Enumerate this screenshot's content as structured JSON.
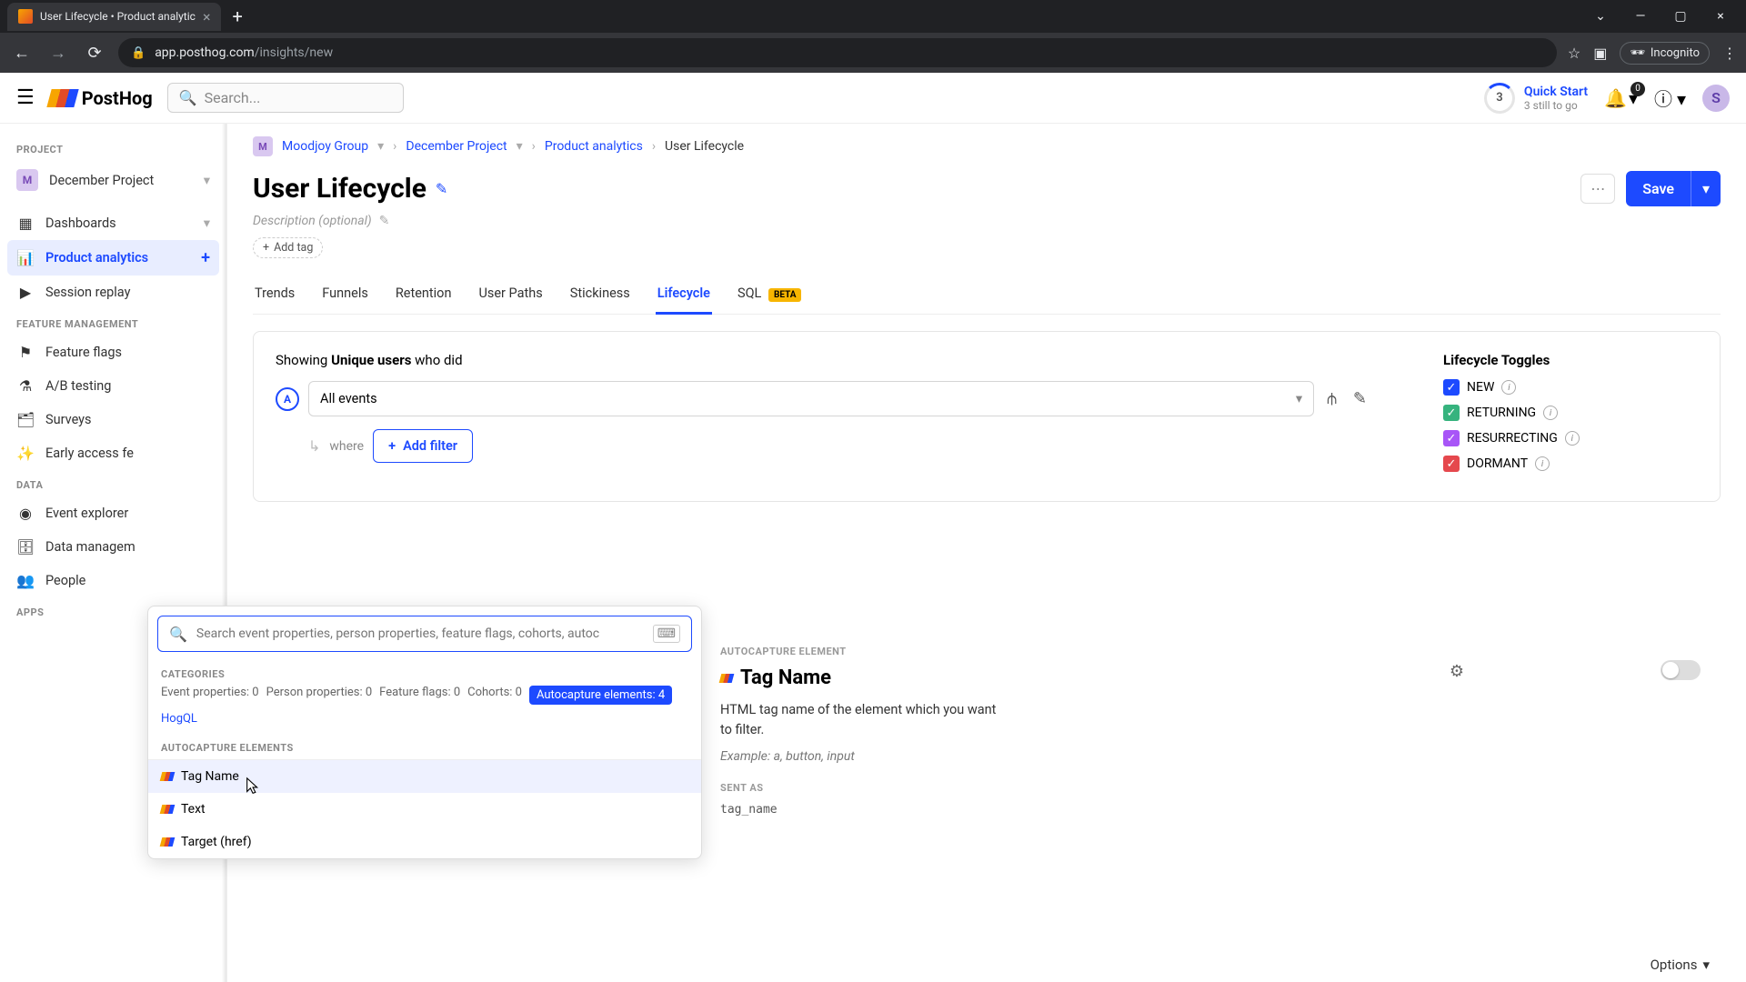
{
  "browser": {
    "tab_title": "User Lifecycle • Product analytic",
    "url_host": "app.posthog.com",
    "url_path": "/insights/new",
    "incognito_label": "Incognito"
  },
  "header": {
    "search_placeholder": "Search...",
    "quick_start": {
      "count": "3",
      "title": "Quick Start",
      "subtitle": "3 still to go"
    },
    "notifications": "0",
    "avatar_letter": "S"
  },
  "sidebar": {
    "project_label": "PROJECT",
    "project_name": "December Project",
    "project_initial": "M",
    "items_main": [
      {
        "icon": "◫",
        "label": "Dashboards",
        "caret": true
      },
      {
        "icon": "⫾⫾",
        "label": "Product analytics",
        "active": true,
        "plus": true
      },
      {
        "icon": "▷",
        "label": "Session replay"
      }
    ],
    "feature_label": "FEATURE MANAGEMENT",
    "items_feature": [
      {
        "icon": "⚑",
        "label": "Feature flags"
      },
      {
        "icon": "⚗",
        "label": "A/B testing"
      },
      {
        "icon": "☑",
        "label": "Surveys"
      },
      {
        "icon": "✧",
        "label": "Early access fe"
      }
    ],
    "data_label": "DATA",
    "items_data": [
      {
        "icon": "((•))",
        "label": "Event explorer"
      },
      {
        "icon": "⊞",
        "label": "Data managem"
      },
      {
        "icon": "👥",
        "label": "People"
      }
    ],
    "apps_label": "APPS"
  },
  "breadcrumb": {
    "initial": "M",
    "items": [
      "Moodjoy Group",
      "December Project",
      "Product analytics",
      "User Lifecycle"
    ]
  },
  "page": {
    "title": "User Lifecycle",
    "description_placeholder": "Description (optional)",
    "add_tag_label": "Add tag",
    "save_label": "Save"
  },
  "tabs": [
    "Trends",
    "Funnels",
    "Retention",
    "User Paths",
    "Stickiness",
    "Lifecycle",
    "SQL"
  ],
  "tabs_active": "Lifecycle",
  "beta_label": "BETA",
  "config": {
    "showing_prefix": "Showing ",
    "showing_bold": "Unique users",
    "showing_suffix": " who did",
    "series_letter": "A",
    "event_label": "All events",
    "where_label": "where",
    "add_filter_label": "Add filter",
    "toggles_title": "Lifecycle Toggles",
    "toggles": [
      {
        "color": "blue",
        "label": "NEW"
      },
      {
        "color": "green",
        "label": "RETURNING"
      },
      {
        "color": "purple",
        "label": "RESURRECTING"
      },
      {
        "color": "red",
        "label": "DORMANT"
      }
    ]
  },
  "filter_popup": {
    "search_placeholder": "Search event properties, person properties, feature flags, cohorts, autoc",
    "categories_label": "CATEGORIES",
    "chips": [
      {
        "text": "Event properties: 0",
        "kind": "muted"
      },
      {
        "text": "Person properties: 0",
        "kind": "muted"
      },
      {
        "text": "Feature flags: 0",
        "kind": "muted"
      },
      {
        "text": "Cohorts: 0",
        "kind": "muted"
      },
      {
        "text": "Autocapture elements: 4",
        "kind": "active"
      },
      {
        "text": "HogQL",
        "kind": "link"
      }
    ],
    "section_label": "AUTOCAPTURE ELEMENTS",
    "items": [
      {
        "label": "Tag Name",
        "highlighted": true
      },
      {
        "label": "Text",
        "highlighted": false
      },
      {
        "label": "Target (href)",
        "highlighted": false
      }
    ]
  },
  "detail": {
    "section_label": "AUTOCAPTURE ELEMENT",
    "title": "Tag Name",
    "description": "HTML tag name of the element which you want to filter.",
    "example": "Example: a, button, input",
    "sent_as_label": "SENT AS",
    "sent_as_value": "tag_name"
  },
  "options_label": "Options"
}
